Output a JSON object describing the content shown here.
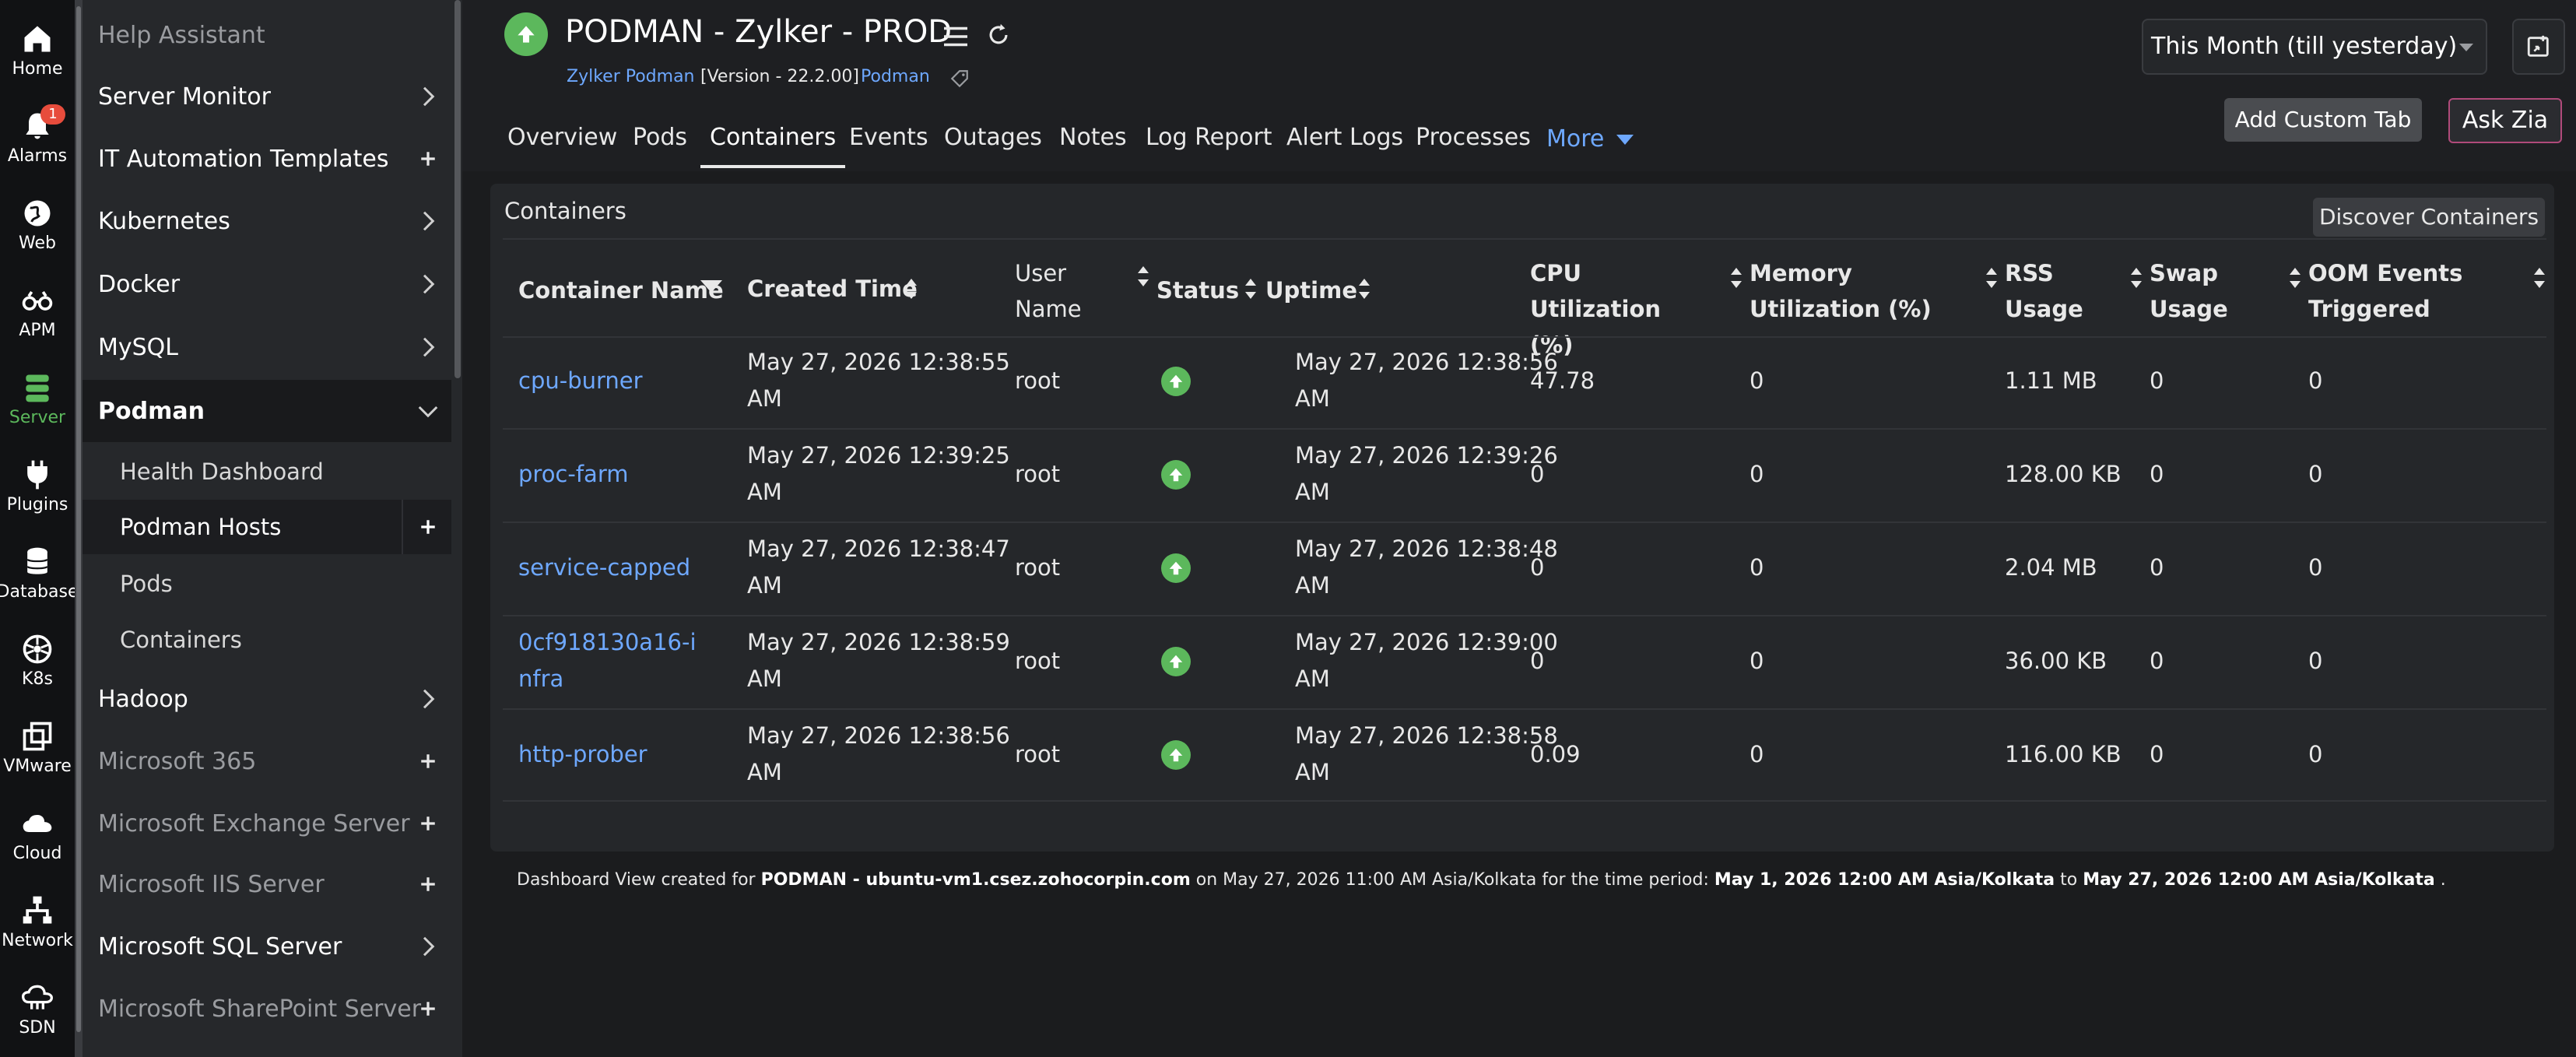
{
  "rail": [
    {
      "label": "Home",
      "icon": "home-icon"
    },
    {
      "label": "Alarms",
      "icon": "bell-icon",
      "badge": "1"
    },
    {
      "label": "Web",
      "icon": "globe-icon"
    },
    {
      "label": "APM",
      "icon": "binoculars-icon"
    },
    {
      "label": "Server",
      "icon": "server-icon"
    },
    {
      "label": "Plugins",
      "icon": "plug-icon"
    },
    {
      "label": "Database",
      "icon": "database-icon"
    },
    {
      "label": "K8s",
      "icon": "k8s-icon"
    },
    {
      "label": "VMware",
      "icon": "vmware-icon"
    },
    {
      "label": "Cloud",
      "icon": "cloud-icon"
    },
    {
      "label": "Network",
      "icon": "network-icon"
    },
    {
      "label": "SDN",
      "icon": "sdn-icon"
    }
  ],
  "sidebar": {
    "items": [
      {
        "label": "Help Assistant"
      },
      {
        "label": "Server Monitor"
      },
      {
        "label": "IT Automation Templates"
      },
      {
        "label": "Kubernetes"
      },
      {
        "label": "Docker"
      },
      {
        "label": "MySQL"
      },
      {
        "label": "Podman"
      },
      {
        "label": "Health Dashboard"
      },
      {
        "label": "Podman Hosts"
      },
      {
        "label": "Pods"
      },
      {
        "label": "Containers"
      },
      {
        "label": "Hadoop"
      },
      {
        "label": "Microsoft 365"
      },
      {
        "label": "Microsoft Exchange Server"
      },
      {
        "label": "Microsoft IIS Server"
      },
      {
        "label": "Microsoft SQL Server"
      },
      {
        "label": "Microsoft SharePoint Server"
      }
    ]
  },
  "header": {
    "title": "PODMAN - Zylker - PROD",
    "group": "Zylker Podman",
    "version": "[Version - 22.2.00]",
    "type": "Podman"
  },
  "tabs": [
    "Overview",
    "Pods",
    "Containers",
    "Events",
    "Outages",
    "Notes",
    "Log Report",
    "Alert Logs",
    "Processes",
    "More"
  ],
  "period": {
    "selected": "This Month (till yesterday)"
  },
  "buttons": {
    "add_custom_tab": "Add Custom Tab",
    "ask_zia": "Ask Zia"
  },
  "panel": {
    "title": "Containers",
    "discover": "Discover Containers",
    "columns": [
      "Container Name",
      "Created Time",
      "User Name",
      "Status",
      "Uptime",
      "CPU Utilization (%)",
      "Memory Utilization (%)",
      "RSS Usage",
      "Swap Usage",
      "OOM Events Triggered"
    ],
    "rows": [
      {
        "name": "cpu-burner",
        "created_l1": "May 27, 2026 12:38:55",
        "created_l2": "AM",
        "user": "root",
        "status": "up",
        "uptime_l1": "May 27, 2026 12:38:56",
        "uptime_l2": "AM",
        "cpu": "47.78",
        "mem": "0",
        "rss": "1.11 MB",
        "swap": "0",
        "oom": "0"
      },
      {
        "name": "proc-farm",
        "created_l1": "May 27, 2026 12:39:25",
        "created_l2": "AM",
        "user": "root",
        "status": "up",
        "uptime_l1": "May 27, 2026 12:39:26",
        "uptime_l2": "AM",
        "cpu": "0",
        "mem": "0",
        "rss": "128.00 KB",
        "swap": "0",
        "oom": "0"
      },
      {
        "name": "service-capped",
        "created_l1": "May 27, 2026 12:38:47",
        "created_l2": "AM",
        "user": "root",
        "status": "up",
        "uptime_l1": "May 27, 2026 12:38:48",
        "uptime_l2": "AM",
        "cpu": "0",
        "mem": "0",
        "rss": "2.04 MB",
        "swap": "0",
        "oom": "0"
      },
      {
        "name": "0cf918130a16-infra",
        "created_l1": "May 27, 2026 12:38:59",
        "created_l2": "AM",
        "user": "root",
        "status": "up",
        "uptime_l1": "May 27, 2026 12:39:00",
        "uptime_l2": "AM",
        "cpu": "0",
        "mem": "0",
        "rss": "36.00 KB",
        "swap": "0",
        "oom": "0"
      },
      {
        "name": "http-prober",
        "created_l1": "May 27, 2026 12:38:56",
        "created_l2": "AM",
        "user": "root",
        "status": "up",
        "uptime_l1": "May 27, 2026 12:38:58",
        "uptime_l2": "AM",
        "cpu": "0.09",
        "mem": "0",
        "rss": "116.00 KB",
        "swap": "0",
        "oom": "0"
      }
    ]
  },
  "footer": {
    "prefix": "Dashboard View created for ",
    "monitor": "PODMAN - ubuntu-vm1.csez.zohocorpin.com",
    "on": " on May 27, 2026 11:00 AM Asia/Kolkata for the time period: ",
    "from": "May 1, 2026 12:00 AM Asia/Kolkata",
    "to_word": " to ",
    "to": "May 27, 2026 12:00 AM Asia/Kolkata",
    "end": " ."
  },
  "colors": {
    "accent_link": "#6ea8ff",
    "status_up": "#5cb85c",
    "badge": "#e74c3c"
  }
}
